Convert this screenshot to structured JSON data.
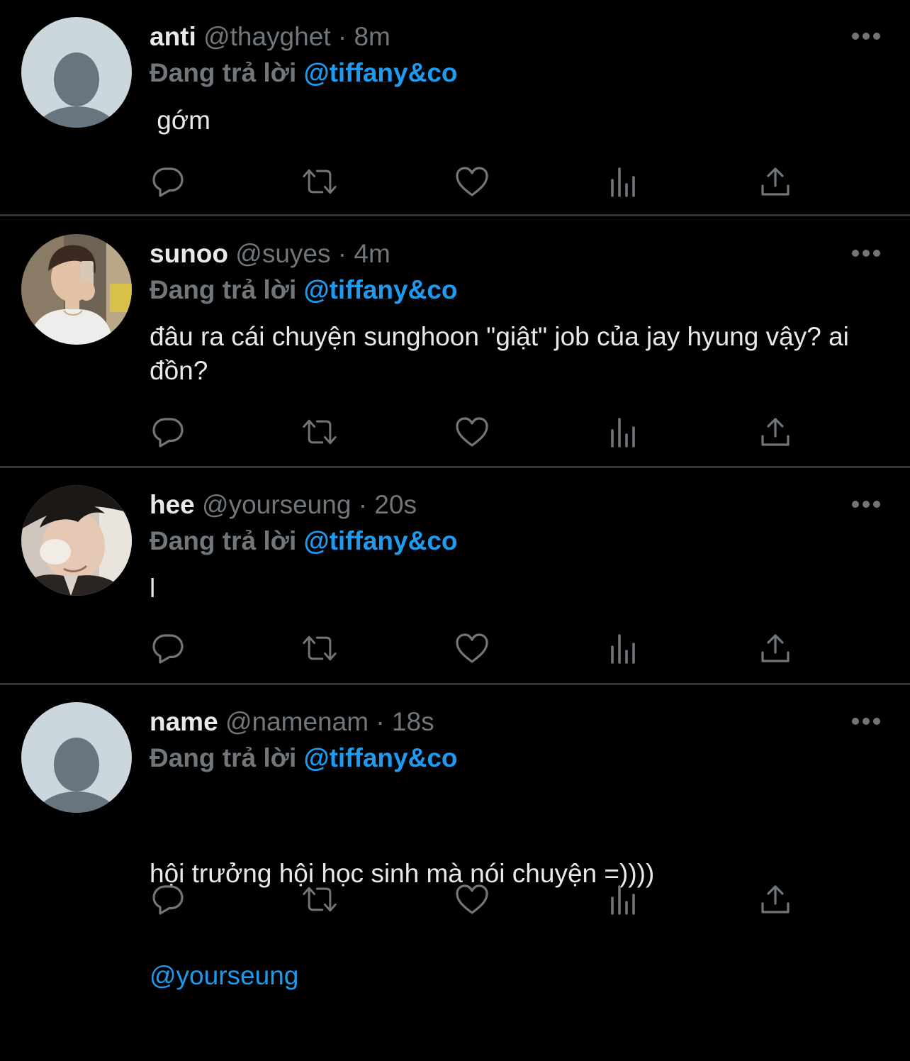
{
  "colors": {
    "background": "#000000",
    "primary_text": "#e7e9ea",
    "secondary_text": "#71767b",
    "accent": "#1d9bf0",
    "divider": "#2f3336"
  },
  "action_icons": [
    "reply-icon",
    "retweet-icon",
    "like-icon",
    "analytics-icon",
    "share-icon"
  ],
  "tweets": [
    {
      "display_name": "anti",
      "handle": "@thayghet",
      "separator": "·",
      "time": "8m",
      "reply_prefix": "Đang trả lời",
      "reply_to": "@tiffany&co",
      "text": " gớm",
      "avatar": "default-avatar-icon"
    },
    {
      "display_name": "sunoo",
      "handle": "@suyes",
      "separator": "·",
      "time": "4m",
      "reply_prefix": "Đang trả lời",
      "reply_to": "@tiffany&co",
      "text": "đâu ra cái chuyện sunghoon \"giật\" job của jay hyung vậy? ai đồn?",
      "avatar": "profile-photo"
    },
    {
      "display_name": "hee",
      "handle": "@yourseung",
      "separator": "·",
      "time": "20s",
      "reply_prefix": "Đang trả lời",
      "reply_to": "@tiffany&co",
      "text": "l",
      "avatar": "profile-photo"
    },
    {
      "display_name": "name",
      "handle": "@namenam",
      "separator": "·",
      "time": "18s",
      "reply_prefix": "Đang trả lời",
      "reply_to": "@tiffany&co",
      "text": "hội trưởng hội học sinh mà nói chuyện =))))",
      "mention": "@yourseung",
      "avatar": "default-avatar-icon"
    }
  ]
}
